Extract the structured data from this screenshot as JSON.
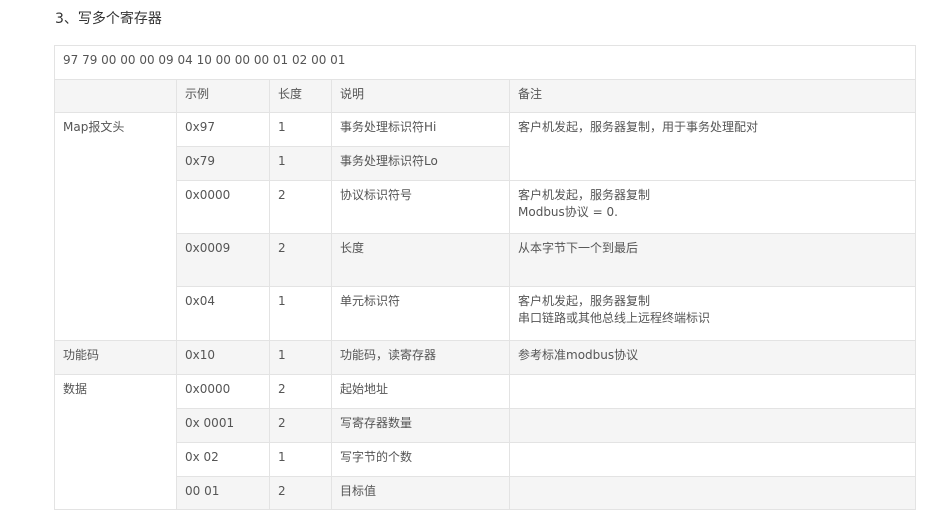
{
  "heading": "3、写多个寄存器",
  "table": {
    "hex_string": "97 79 00 00 00 09 04 10 00 00 00 01 02 00 01",
    "headers": [
      "",
      "示例",
      "长度",
      "说明",
      "备注"
    ],
    "groups": {
      "map": "Map报文头",
      "func": "功能码",
      "data": "数据"
    },
    "rows": [
      {
        "example": "0x97",
        "length": "1",
        "desc": "事务处理标识符Hi"
      },
      {
        "example": "0x79",
        "length": "1",
        "desc": "事务处理标识符Lo"
      },
      {
        "example": "0x0000",
        "length": "2",
        "desc": "协议标识符号"
      },
      {
        "example": "0x0009",
        "length": "2",
        "desc": "长度"
      },
      {
        "example": "0x04",
        "length": "1",
        "desc": "单元标识符"
      },
      {
        "example": "0x10",
        "length": "1",
        "desc": "功能码，读寄存器"
      },
      {
        "example": "0x0000",
        "length": "2",
        "desc": "起始地址"
      },
      {
        "example": "0x 0001",
        "length": "2",
        "desc": "写寄存器数量"
      },
      {
        "example": "0x 02",
        "length": "1",
        "desc": "写字节的个数"
      },
      {
        "example": "00 01",
        "length": "2",
        "desc": "目标值"
      }
    ],
    "notes": {
      "transaction": "客户机发起，服务器复制，用于事务处理配对",
      "protocol_1": "客户机发起，服务器复制",
      "protocol_2": "Modbus协议 = 0.",
      "length": "从本字节下一个到最后",
      "unit_1": "客户机发起，服务器复制",
      "unit_2": "串口链路或其他总线上远程终端标识",
      "func": "参考标准modbus协议"
    }
  }
}
